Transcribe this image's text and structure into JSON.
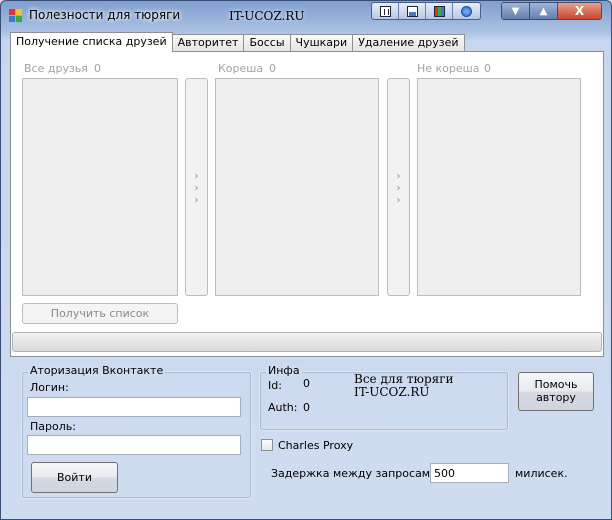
{
  "window": {
    "title": "Полезности для тюряги",
    "watermark": "IT-UCOZ.RU",
    "system_buttons": {
      "minimize": "▼",
      "maximize": "▲",
      "close": "X"
    }
  },
  "tabs": [
    {
      "label": "Получение списка друзей",
      "active": true
    },
    {
      "label": "Авторитет",
      "active": false
    },
    {
      "label": "Боссы",
      "active": false
    },
    {
      "label": "Чушкари",
      "active": false
    },
    {
      "label": "Удаление друзей",
      "active": false
    }
  ],
  "friends_tab": {
    "all_friends": {
      "label": "Все друзья",
      "count": "0"
    },
    "koresha": {
      "label": "Кореша",
      "count": "0"
    },
    "ne_koresha": {
      "label": "Не кореша",
      "count": "0"
    },
    "move_arrows": ">\n>\n>",
    "get_list_button": "Получить список",
    "progress_percent": 0
  },
  "auth": {
    "group_title": "Аторизация Вконтакте",
    "login_label": "Логин:",
    "login_value": "",
    "password_label": "Пароль:",
    "password_value": "",
    "login_button": "Войти"
  },
  "info": {
    "group_title": "Инфа",
    "id_label": "Id:",
    "id_value": "0",
    "auth_label": "Auth:",
    "auth_value": "0",
    "watermark_line1": "Все для тюряги",
    "watermark_line2": "IT-UCOZ.RU"
  },
  "help_author_button": "Помочь\nавтору",
  "charles_proxy": {
    "label": "Charles Proxy",
    "checked": false
  },
  "delay": {
    "label": "Задержка между запросами:",
    "value": "500",
    "unit": "милисек."
  },
  "colors": {
    "window_bg": "#cfdcf0",
    "list_bg": "#efefef",
    "disabled_text": "#a3a3a3"
  }
}
